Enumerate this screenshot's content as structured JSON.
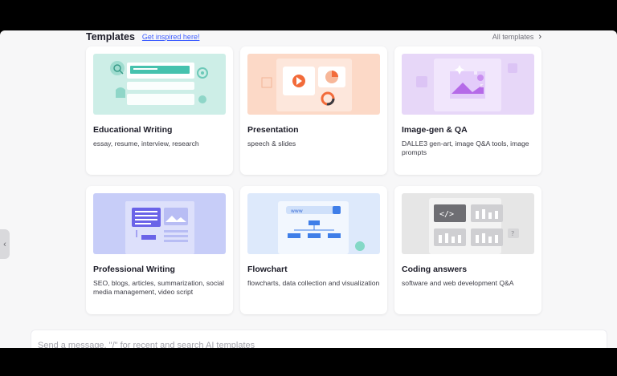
{
  "header": {
    "title": "Templates",
    "inspire_link": "Get inspired here!",
    "all_templates": "All templates"
  },
  "templates": [
    {
      "title": "Educational Writing",
      "description": "essay, resume, interview, research",
      "thumb_bg": "#cdeee7",
      "icon": "educational-writing-illustration"
    },
    {
      "title": "Presentation",
      "description": "speech & slides",
      "thumb_bg": "#fcd9c7",
      "icon": "presentation-illustration"
    },
    {
      "title": "Image-gen & QA",
      "description": "DALLE3 gen-art, image Q&A tools, image prompts",
      "thumb_bg": "#e7d7f8",
      "icon": "image-gen-illustration"
    },
    {
      "title": "Professional Writing",
      "description": "SEO, blogs, articles, summarization, social media management, video script",
      "thumb_bg": "#c7cdf8",
      "icon": "professional-writing-illustration"
    },
    {
      "title": "Flowchart",
      "description": "flowcharts, data collection and visualization",
      "thumb_bg": "#dde9fb",
      "icon": "flowchart-illustration"
    },
    {
      "title": "Coding answers",
      "description": "software and web development Q&A",
      "thumb_bg": "#e6e6e6",
      "icon": "coding-illustration"
    }
  ],
  "input": {
    "placeholder": "Send a message, \"/\" for recent and search AI templates"
  },
  "colors": {
    "accent_link": "#3b5bff",
    "page_bg": "#f7f7f8"
  }
}
